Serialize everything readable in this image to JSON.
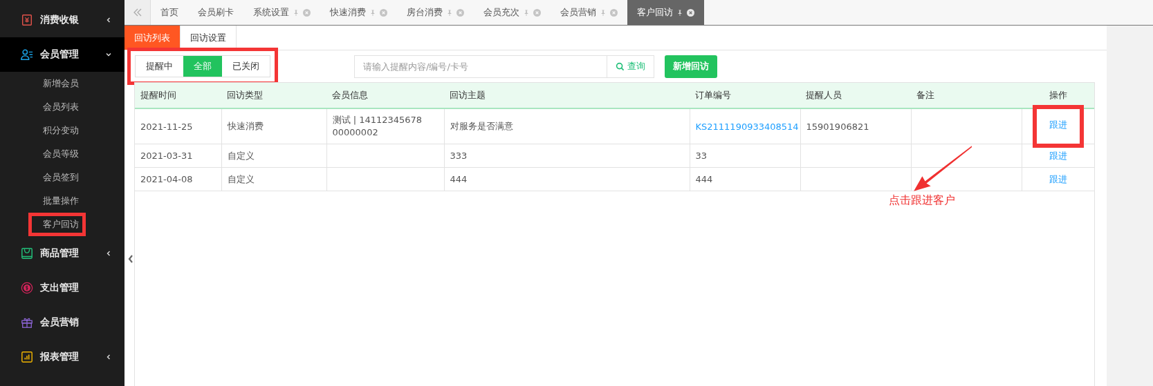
{
  "sidebar": {
    "items": [
      {
        "label": "消费收银",
        "kind": "group",
        "expanded": false
      },
      {
        "label": "会员管理",
        "kind": "group",
        "expanded": true,
        "children": [
          {
            "label": "新增会员",
            "highlighted": false
          },
          {
            "label": "会员列表",
            "highlighted": false
          },
          {
            "label": "积分变动",
            "highlighted": false
          },
          {
            "label": "会员等级",
            "highlighted": false
          },
          {
            "label": "会员签到",
            "highlighted": false
          },
          {
            "label": "批量操作",
            "highlighted": false
          },
          {
            "label": "客户回访",
            "highlighted": true
          }
        ]
      },
      {
        "label": "商品管理",
        "kind": "group",
        "expanded": false
      },
      {
        "label": "支出管理",
        "kind": "link"
      },
      {
        "label": "会员营销",
        "kind": "link"
      },
      {
        "label": "报表管理",
        "kind": "group",
        "expanded": false
      }
    ]
  },
  "tabs": [
    {
      "label": "首页",
      "closable": false,
      "selected": false
    },
    {
      "label": "会员刷卡",
      "closable": false,
      "selected": false
    },
    {
      "label": "系统设置",
      "closable": true,
      "selected": false
    },
    {
      "label": "快速消费",
      "closable": true,
      "selected": false
    },
    {
      "label": "房台消费",
      "closable": true,
      "selected": false
    },
    {
      "label": "会员充次",
      "closable": true,
      "selected": false
    },
    {
      "label": "会员营销",
      "closable": true,
      "selected": false
    },
    {
      "label": "客户回访",
      "closable": true,
      "selected": true
    }
  ],
  "sub_tabs": [
    {
      "label": "回访列表",
      "selected": true
    },
    {
      "label": "回访设置",
      "selected": false
    }
  ],
  "filters": {
    "highlighted": true,
    "options": [
      {
        "label": "提醒中",
        "selected": false
      },
      {
        "label": "全部",
        "selected": true
      },
      {
        "label": "已关闭",
        "selected": false
      }
    ]
  },
  "search": {
    "placeholder": "请输入提醒内容/编号/卡号",
    "button": "查询"
  },
  "add_button": "新增回访",
  "table": {
    "columns": [
      "提醒时间",
      "回访类型",
      "会员信息",
      "回访主题",
      "订单编号",
      "提醒人员",
      "备注",
      "操作"
    ],
    "rows": [
      {
        "time": "2021-11-25",
        "type": "快速消费",
        "member": [
          "测试 | 14112345678",
          "00000002"
        ],
        "subject": "对服务是否满意",
        "order": "KS2111190933408514",
        "order_link": true,
        "reminder": "15901906821",
        "note": "",
        "action": "跟进",
        "action_highlighted": true
      },
      {
        "time": "2021-03-31",
        "type": "自定义",
        "member": [],
        "subject": "333",
        "order": "33",
        "order_link": false,
        "reminder": "",
        "note": "",
        "action": "跟进",
        "action_highlighted": false
      },
      {
        "time": "2021-04-08",
        "type": "自定义",
        "member": [],
        "subject": "444",
        "order": "444",
        "order_link": false,
        "reminder": "",
        "note": "",
        "action": "跟进",
        "action_highlighted": false
      }
    ]
  },
  "annotation": "点击跟进客户"
}
